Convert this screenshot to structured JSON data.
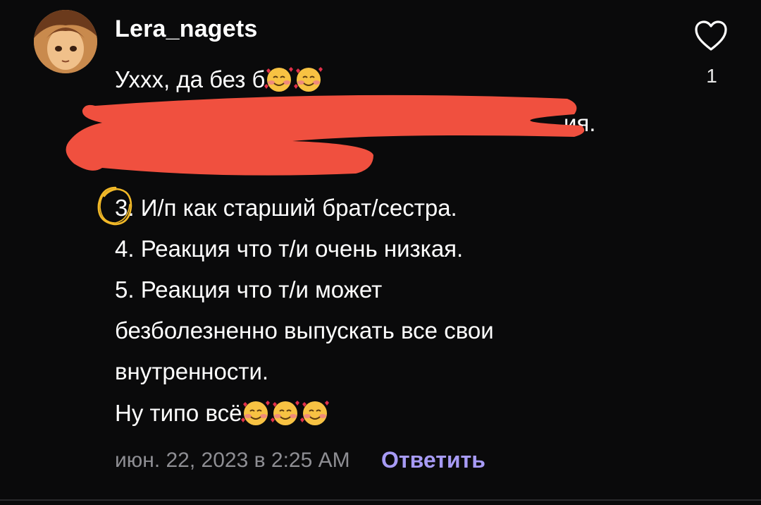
{
  "comment": {
    "username": "Lera_nagets",
    "like_count": "1",
    "lines": {
      "line1": "Ухxx, да без б",
      "line2_tail": "ия.",
      "line3": "И/п  как старший брат/сестра.",
      "line3_number": "3.",
      "line4": "4. Реакция что т/и очень низкая.",
      "line5": "5. Реакция что т/и может",
      "line6": "безболезненно выпускать все  свои",
      "line7": "внутренности.",
      "line8": "Ну типо всё"
    },
    "timestamp": "июн. 22, 2023 в 2:25 AM",
    "reply_label": "Ответить"
  },
  "icons": {
    "like": "heart-outline-icon",
    "emoji": "smiling-face-with-hearts"
  },
  "colors": {
    "background": "#0a0a0b",
    "reply_accent": "#a79bf5",
    "meta_gray": "#8e8e93",
    "redaction": "#f0503f",
    "circle_mark": "#f2b928"
  }
}
